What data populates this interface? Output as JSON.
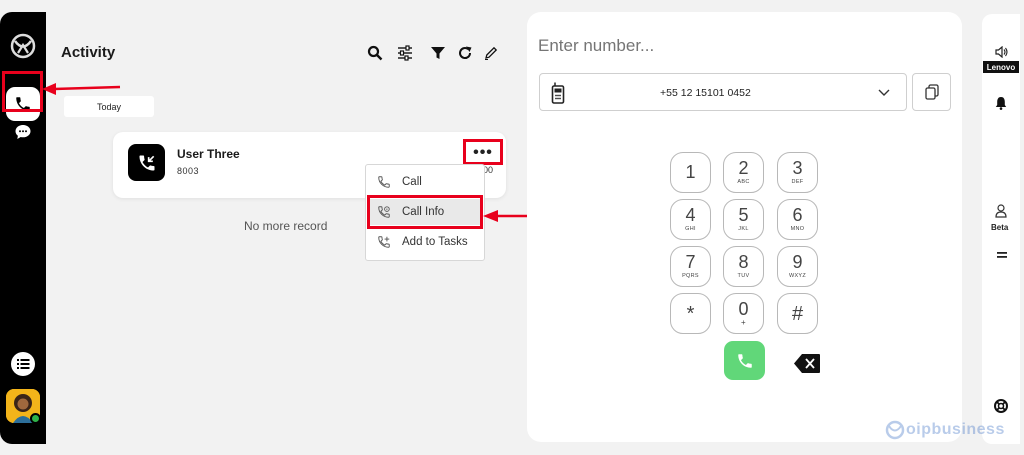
{
  "activity": {
    "title": "Activity",
    "today_label": "Today",
    "card": {
      "name": "User Three",
      "extension": "8003",
      "time_fragment": "00",
      "more_label": "•••"
    },
    "no_more_label": "No more record",
    "menu": [
      {
        "label": "Call",
        "icon": "phone-icon"
      },
      {
        "label": "Call Info",
        "icon": "call-info-icon"
      },
      {
        "label": "Add to Tasks",
        "icon": "add-task-icon"
      }
    ],
    "toolbar": [
      "search-icon",
      "sliders-icon",
      "filter-icon",
      "refresh-icon",
      "edit-icon"
    ]
  },
  "dialer": {
    "placeholder": "Enter number...",
    "selected_number": "+55 12 15101 0452",
    "keys": [
      {
        "digit": "1",
        "sub": ""
      },
      {
        "digit": "2",
        "sub": "ABC"
      },
      {
        "digit": "3",
        "sub": "DEF"
      },
      {
        "digit": "4",
        "sub": "GHI"
      },
      {
        "digit": "5",
        "sub": "JKL"
      },
      {
        "digit": "6",
        "sub": "MNO"
      },
      {
        "digit": "7",
        "sub": "PQRS"
      },
      {
        "digit": "8",
        "sub": "TUV"
      },
      {
        "digit": "9",
        "sub": "WXYZ"
      },
      {
        "digit": "*",
        "sub": ""
      },
      {
        "digit": "0",
        "sub": "+"
      },
      {
        "digit": "#",
        "sub": ""
      }
    ]
  },
  "right_rail": {
    "brand": "Lenovo",
    "beta_label": "Beta"
  },
  "watermark": "oipbusiness",
  "colors": {
    "highlight": "#e8001c",
    "call_green": "#61d779",
    "rail": "#000000"
  }
}
